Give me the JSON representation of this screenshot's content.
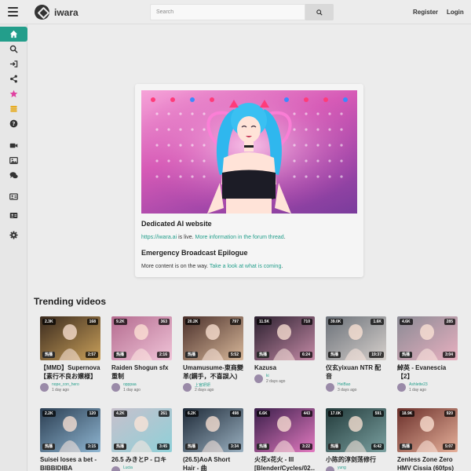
{
  "header": {
    "brand": "iwara",
    "search_placeholder": "Search",
    "register_label": "Register",
    "login_label": "Login"
  },
  "sidebar": {
    "items": [
      {
        "name": "home-icon",
        "color": "#ffffff"
      },
      {
        "name": "search-icon",
        "color": "#333333"
      },
      {
        "name": "sign-in-icon",
        "color": "#333333"
      },
      {
        "name": "share-icon",
        "color": "#333333"
      },
      {
        "name": "star-icon",
        "color": "#e040a0"
      },
      {
        "name": "coins-icon",
        "color": "#e6a817"
      },
      {
        "name": "help-icon",
        "color": "#333333"
      },
      {
        "name": "video-icon",
        "color": "#333333"
      },
      {
        "name": "image-icon",
        "color": "#333333"
      },
      {
        "name": "chat-icon",
        "color": "#333333"
      },
      {
        "name": "id-card-icon",
        "color": "#333333"
      },
      {
        "name": "profile-card-icon",
        "color": "#333333"
      },
      {
        "name": "settings-icon",
        "color": "#333333"
      }
    ]
  },
  "announcement": {
    "title1": "Dedicated AI website",
    "line1_link": "https://iwara.ai",
    "line1_text": " is live. ",
    "line1_link2": "More information in the forum thread",
    "line1_end": ".",
    "title2": "Emergency Broadcast Epilogue",
    "line2_text": "More content is on the way. ",
    "line2_link": "Take a look at what is coming",
    "line2_end": "."
  },
  "trending": {
    "title": "Trending videos",
    "videos": [
      {
        "title": "【MMD】Supernova【素行不良お嬢様】",
        "author": "nope_con_hero",
        "date": "1 day ago",
        "views": "2.3K",
        "likes": "168",
        "duration": "2:57",
        "tag": "热播",
        "c1": "#3a2a1e",
        "c2": "#c9a05a"
      },
      {
        "title": "Raiden Shogun sfx重制",
        "author": "opppaa",
        "date": "1 day ago",
        "views": "9.2K",
        "likes": "363",
        "duration": "2:16",
        "tag": "热播",
        "c1": "#b46b8f",
        "c2": "#f0c4d8"
      },
      {
        "title": "Umamusume-東商變革(鋼手，不喜誤入)",
        "author": "上官妍妍",
        "date": "2 days ago",
        "views": "20.2K",
        "likes": "797",
        "duration": "5:52",
        "tag": "热播",
        "c1": "#4a2f2a",
        "c2": "#d8b89a"
      },
      {
        "title": "Kazusa",
        "author": "ki",
        "date": "2 days ago",
        "views": "11.5K",
        "likes": "710",
        "duration": "6:24",
        "tag": "热播",
        "c1": "#2a1f2e",
        "c2": "#c48aa6"
      },
      {
        "title": "仪玄yixuan NTR 配音",
        "author": "HeiBao",
        "date": "3 days ago",
        "views": "39.0K",
        "likes": "1.6K",
        "duration": "19:37",
        "tag": "热播",
        "c1": "#6a7078",
        "c2": "#d6d0cc"
      },
      {
        "title": "綽英 - Evanescia【2】",
        "author": "Ashlette23",
        "date": "1 day ago",
        "views": "4.6K",
        "likes": "285",
        "duration": "3:04",
        "tag": "热播",
        "c1": "#8a8a94",
        "c2": "#e8b0c0"
      },
      {
        "title": "Suisei loses a bet - BIBBIDIBA",
        "author": "",
        "date": "",
        "views": "2.2K",
        "likes": "120",
        "duration": "3:15",
        "tag": "热播",
        "c1": "#2b3e52",
        "c2": "#8fb6d2"
      },
      {
        "title": "26.5 みきとP - ロキ",
        "author": "Lucia",
        "date": "",
        "views": "4.2K",
        "likes": "261",
        "duration": "3:45",
        "tag": "热播",
        "c1": "#c7c0cc",
        "c2": "#8fd0d8"
      },
      {
        "title": "(26.5)AoA Short Hair - 曲",
        "author": "",
        "date": "",
        "views": "6.2K",
        "likes": "498",
        "duration": "3:34",
        "tag": "热播",
        "c1": "#1e2a38",
        "c2": "#9ab0c0"
      },
      {
        "title": "火花x花火 - III [Blender/Cycles/02...",
        "author": "",
        "date": "",
        "views": "6.6K",
        "likes": "443",
        "duration": "3:22",
        "tag": "热播",
        "c1": "#3a1e4a",
        "c2": "#e27ac0"
      },
      {
        "title": "小陈的淳剑荡修行",
        "author": "yung",
        "date": "",
        "views": "17.0K",
        "likes": "591",
        "duration": "6:42",
        "tag": "热播",
        "c1": "#223a3a",
        "c2": "#7aa0a0"
      },
      {
        "title": "Zenless Zone Zero HMV Cissia (60fps)",
        "author": "",
        "date": "",
        "views": "18.9K",
        "likes": "920",
        "duration": "5:07",
        "tag": "热播",
        "c1": "#6a2f2a",
        "c2": "#e6b09a"
      }
    ]
  }
}
